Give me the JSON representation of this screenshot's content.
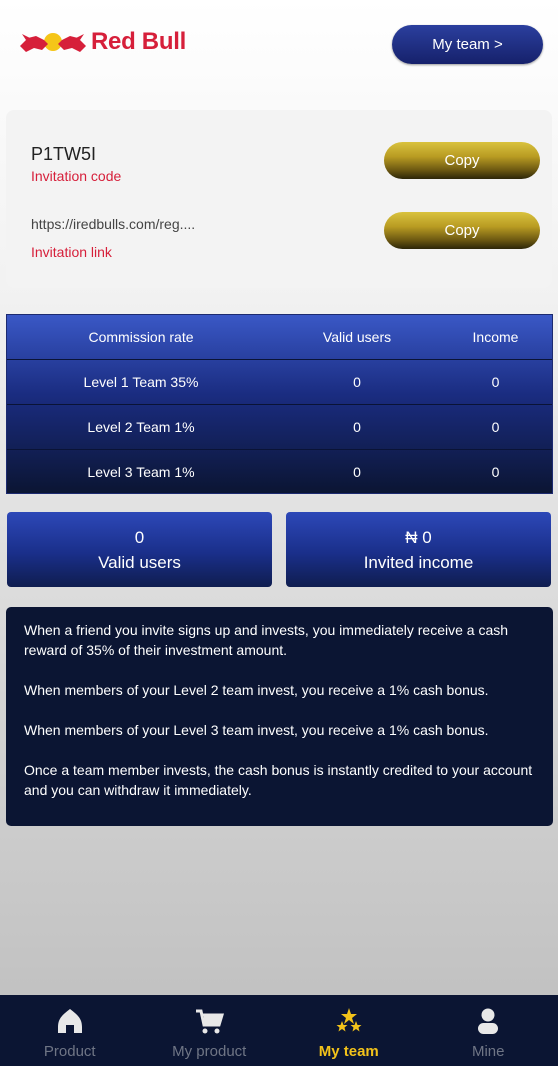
{
  "header": {
    "brand": "Red Bull",
    "my_team_button": "My team >"
  },
  "invite": {
    "code_value": "P1TW5I",
    "code_label": "Invitation code",
    "link_value": "https://iredbulls.com/reg....",
    "link_label": "Invitation link",
    "copy_label": "Copy"
  },
  "commission_table": {
    "headers": [
      "Commission rate",
      "Valid users",
      "Income"
    ],
    "rows": [
      [
        "Level 1 Team 35%",
        "0",
        "0"
      ],
      [
        "Level 2 Team 1%",
        "0",
        "0"
      ],
      [
        "Level 3 Team 1%",
        "0",
        "0"
      ]
    ]
  },
  "stats": {
    "valid_users_value": "0",
    "valid_users_label": "Valid users",
    "invited_income_value": "₦ 0",
    "invited_income_label": "Invited income"
  },
  "info": {
    "paragraphs": [
      "When a friend you invite signs up and invests, you immediately receive a cash reward of 35% of their investment amount.",
      "When members of your Level 2 team invest, you receive a 1% cash bonus.",
      "When members of your Level 3 team invest, you receive a 1% cash bonus.",
      "Once a team member invests, the cash bonus is instantly credited to your account and you can withdraw it immediately."
    ]
  },
  "tabs": [
    {
      "label": "Product",
      "icon": "home-icon"
    },
    {
      "label": "My product",
      "icon": "cart-icon"
    },
    {
      "label": "My team",
      "icon": "stars-icon"
    },
    {
      "label": "Mine",
      "icon": "user-icon"
    }
  ],
  "colors": {
    "brand_red": "#d61f3a",
    "navy": "#0b1533",
    "active_tab": "#f2c21a"
  }
}
